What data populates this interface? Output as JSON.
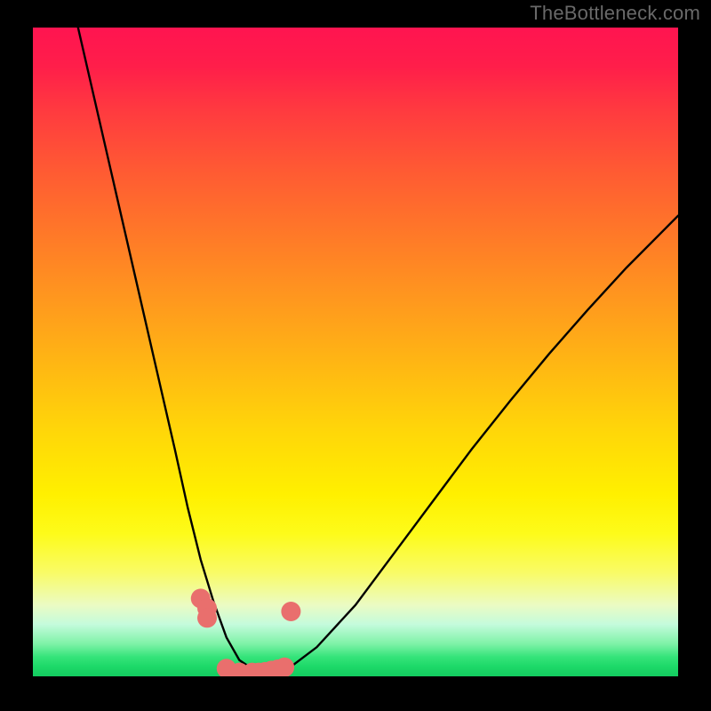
{
  "watermark": "TheBottleneck.com",
  "chart_data": {
    "type": "line",
    "title": "",
    "xlabel": "",
    "ylabel": "",
    "xlim": [
      0,
      100
    ],
    "ylim": [
      0,
      100
    ],
    "grid": false,
    "background_gradient": {
      "direction": "vertical",
      "stops": [
        {
          "pos": 0.0,
          "color": "#ff1450"
        },
        {
          "pos": 0.72,
          "color": "#fff000"
        },
        {
          "pos": 1.0,
          "color": "#13cb5f"
        }
      ]
    },
    "series": [
      {
        "name": "bottleneck-curve",
        "color": "#000000",
        "x": [
          7,
          10,
          13,
          16,
          19,
          22,
          24,
          26,
          28,
          30,
          32,
          35,
          38,
          40,
          44,
          50,
          56,
          62,
          68,
          74,
          80,
          86,
          92,
          98,
          100
        ],
        "values": [
          100,
          87,
          74,
          61,
          48,
          35,
          26,
          18,
          11.5,
          6,
          2.5,
          0.5,
          0.5,
          1.5,
          4.5,
          11,
          19,
          27,
          35,
          42.5,
          49.7,
          56.5,
          63,
          69,
          71
        ]
      },
      {
        "name": "marker-dots",
        "color": "#e96f6d",
        "type": "scatter",
        "x": [
          26,
          27,
          27,
          30,
          32,
          34,
          35,
          36,
          37,
          38,
          39,
          40
        ],
        "values": [
          12,
          10.5,
          9,
          1.2,
          0.6,
          0.6,
          0.6,
          0.7,
          0.9,
          1.1,
          1.4,
          10
        ]
      }
    ]
  }
}
